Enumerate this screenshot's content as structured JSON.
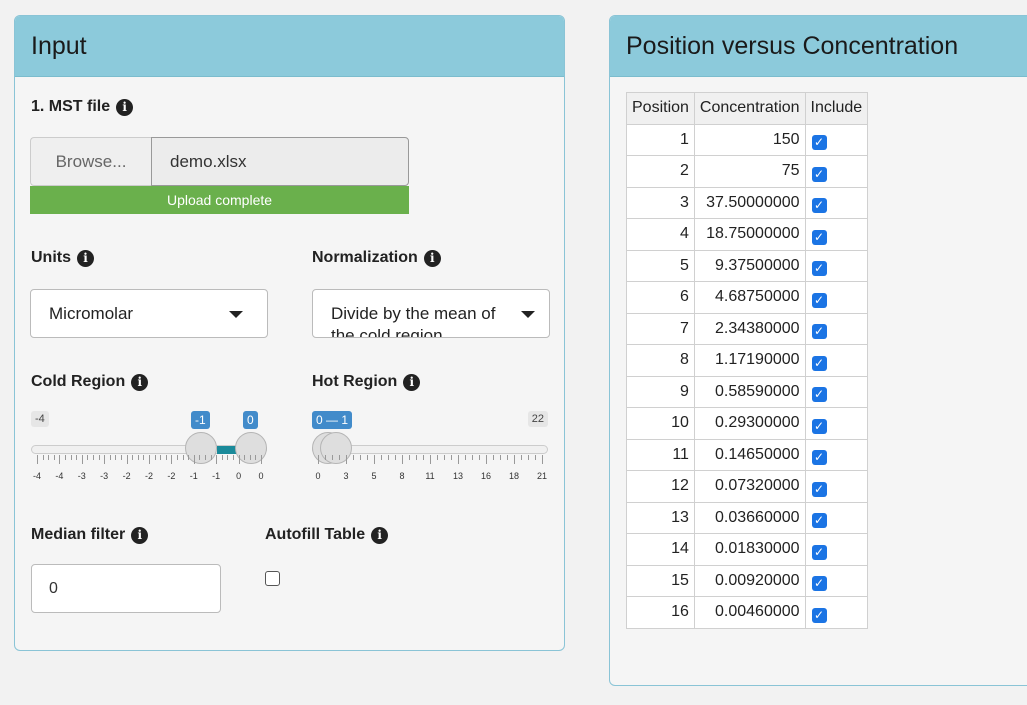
{
  "input_panel": {
    "title": "Input",
    "mst_file": {
      "label": "1. MST file",
      "browse_label": "Browse...",
      "file_name": "demo.xlsx",
      "progress_text": "Upload complete",
      "progress": 1.0
    },
    "units": {
      "label": "Units",
      "value": "Micromolar"
    },
    "normalization": {
      "label": "Normalization",
      "value": "Divide by the mean of the cold region"
    },
    "cold_region": {
      "label": "Cold Region",
      "min": "-4",
      "max": "0",
      "from": "-1",
      "to": "0",
      "tick_labels": [
        "-4",
        "-4",
        "-3",
        "-3",
        "-2",
        "-2",
        "-2",
        "-1",
        "-1",
        "0",
        "0"
      ]
    },
    "hot_region": {
      "label": "Hot Region",
      "min": "0",
      "max": "22",
      "value_badge": "0 — 1",
      "from": "0",
      "to": "1",
      "tick_labels": [
        "0",
        "3",
        "5",
        "8",
        "11",
        "13",
        "16",
        "18",
        "21"
      ]
    },
    "median_filter": {
      "label": "Median filter",
      "value": "0"
    },
    "autofill_table": {
      "label": "Autofill Table",
      "checked": false
    }
  },
  "table_panel": {
    "title": "Position versus Concentration",
    "columns": [
      "Position",
      "Concentration",
      "Include"
    ],
    "rows": [
      {
        "position": "1",
        "concentration": "150",
        "include": true
      },
      {
        "position": "2",
        "concentration": "75",
        "include": true
      },
      {
        "position": "3",
        "concentration": "37.50000000",
        "include": true
      },
      {
        "position": "4",
        "concentration": "18.75000000",
        "include": true
      },
      {
        "position": "5",
        "concentration": "9.37500000",
        "include": true
      },
      {
        "position": "6",
        "concentration": "4.68750000",
        "include": true
      },
      {
        "position": "7",
        "concentration": "2.34380000",
        "include": true
      },
      {
        "position": "8",
        "concentration": "1.17190000",
        "include": true
      },
      {
        "position": "9",
        "concentration": "0.58590000",
        "include": true
      },
      {
        "position": "10",
        "concentration": "0.29300000",
        "include": true
      },
      {
        "position": "11",
        "concentration": "0.14650000",
        "include": true
      },
      {
        "position": "12",
        "concentration": "0.07320000",
        "include": true
      },
      {
        "position": "13",
        "concentration": "0.03660000",
        "include": true
      },
      {
        "position": "14",
        "concentration": "0.01830000",
        "include": true
      },
      {
        "position": "15",
        "concentration": "0.00920000",
        "include": true
      },
      {
        "position": "16",
        "concentration": "0.00460000",
        "include": true
      }
    ]
  },
  "icons": {
    "info": "info-circle-icon",
    "caret": "caret-down-icon",
    "check": "checkmark-icon"
  },
  "colors": {
    "header_bg": "#8ccadb",
    "progress_bar": "#6ab04c",
    "slider_fill": "#1a8a9a",
    "badge": "#428bca",
    "checkbox": "#1b74e4"
  }
}
